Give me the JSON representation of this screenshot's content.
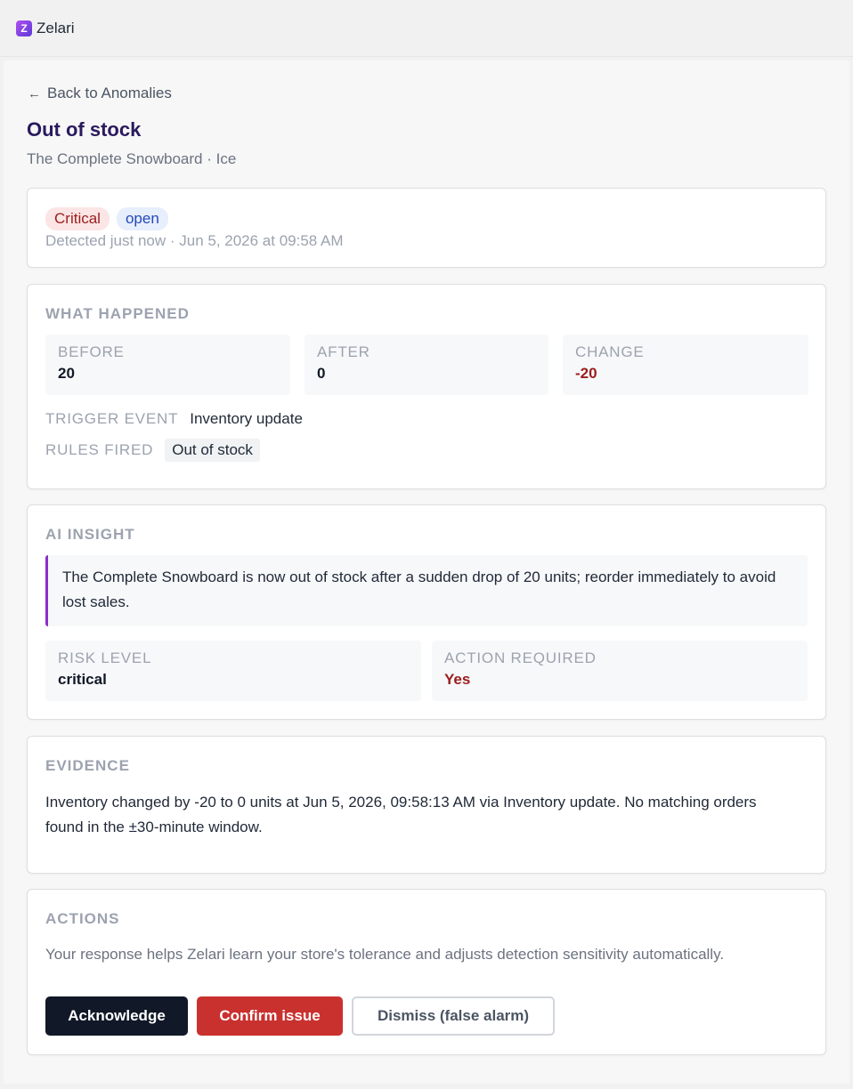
{
  "app": {
    "logo_letter": "Z",
    "name": "Zelari"
  },
  "nav": {
    "back_arrow": "←",
    "back_label": "Back to Anomalies"
  },
  "header": {
    "title": "Out of stock",
    "subtitle": "The Complete Snowboard · Ice"
  },
  "status": {
    "severity": "Critical",
    "state": "open",
    "detected": "Detected just now · Jun 5, 2026 at 09:58 AM"
  },
  "what_happened": {
    "heading": "WHAT HAPPENED",
    "before_label": "BEFORE",
    "before_value": "20",
    "after_label": "AFTER",
    "after_value": "0",
    "change_label": "CHANGE",
    "change_value": "-20",
    "trigger_label": "TRIGGER EVENT",
    "trigger_value": "Inventory update",
    "rules_label": "RULES FIRED",
    "rules_value": "Out of stock"
  },
  "ai_insight": {
    "heading": "AI INSIGHT",
    "text": "The Complete Snowboard is now out of stock after a sudden drop of 20 units; reorder immediately to avoid lost sales.",
    "risk_label": "RISK LEVEL",
    "risk_value": "critical",
    "action_label": "ACTION REQUIRED",
    "action_value": "Yes"
  },
  "evidence": {
    "heading": "EVIDENCE",
    "text": "Inventory changed by -20 to 0 units at Jun 5, 2026, 09:58:13 AM via Inventory update. No matching orders found in the ±30-minute window."
  },
  "actions": {
    "heading": "ACTIONS",
    "description": "Your response helps Zelari learn your store's tolerance and adjusts detection sensitivity automatically.",
    "acknowledge": "Acknowledge",
    "confirm": "Confirm issue",
    "dismiss": "Dismiss (false alarm)"
  },
  "colors": {
    "accent": "#2a1a5e",
    "danger": "#c9312f",
    "insight_border": "#8b2cc9"
  }
}
